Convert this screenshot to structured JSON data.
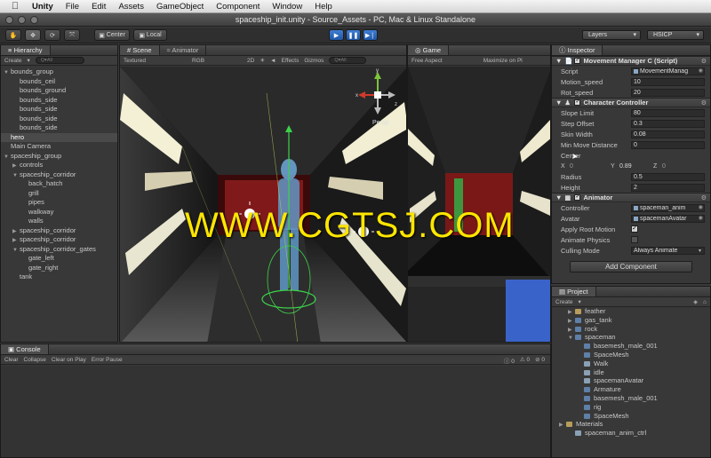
{
  "menubar": {
    "app": "Unity",
    "items": [
      "File",
      "Edit",
      "Assets",
      "GameObject",
      "Component",
      "Window",
      "Help"
    ]
  },
  "window": {
    "title": "spaceship_init.unity - Source_Assets - PC, Mac & Linux Standalone"
  },
  "toolbar": {
    "pivot_label": "Center",
    "space_label": "Local",
    "layers_label": "Layers",
    "layout_label": "HSICP"
  },
  "hierarchy": {
    "tab": "Hierarchy",
    "create_label": "Create",
    "search_placeholder": "Q▾All",
    "items": [
      {
        "label": "bounds_group",
        "depth": 0,
        "arrow": "▼"
      },
      {
        "label": "bounds_ceil",
        "depth": 1,
        "arrow": ""
      },
      {
        "label": "bounds_ground",
        "depth": 1,
        "arrow": ""
      },
      {
        "label": "bounds_side",
        "depth": 1,
        "arrow": ""
      },
      {
        "label": "bounds_side",
        "depth": 1,
        "arrow": ""
      },
      {
        "label": "bounds_side",
        "depth": 1,
        "arrow": ""
      },
      {
        "label": "bounds_side",
        "depth": 1,
        "arrow": ""
      },
      {
        "label": "hero",
        "depth": 0,
        "arrow": "",
        "selected": true
      },
      {
        "label": "Main Camera",
        "depth": 0,
        "arrow": ""
      },
      {
        "label": "spaceship_group",
        "depth": 0,
        "arrow": "▼"
      },
      {
        "label": "controls",
        "depth": 1,
        "arrow": "▶"
      },
      {
        "label": "spaceship_corridor",
        "depth": 1,
        "arrow": "▼"
      },
      {
        "label": "back_hatch",
        "depth": 2,
        "arrow": ""
      },
      {
        "label": "grill",
        "depth": 2,
        "arrow": ""
      },
      {
        "label": "pipes",
        "depth": 2,
        "arrow": ""
      },
      {
        "label": "walkway",
        "depth": 2,
        "arrow": ""
      },
      {
        "label": "walls",
        "depth": 2,
        "arrow": ""
      },
      {
        "label": "spaceship_corridor",
        "depth": 1,
        "arrow": "▶"
      },
      {
        "label": "spaceship_corridor",
        "depth": 1,
        "arrow": "▶"
      },
      {
        "label": "spaceship_corridor_gates",
        "depth": 1,
        "arrow": "▼"
      },
      {
        "label": "gate_left",
        "depth": 2,
        "arrow": ""
      },
      {
        "label": "gate_right",
        "depth": 2,
        "arrow": ""
      },
      {
        "label": "tank",
        "depth": 1,
        "arrow": ""
      }
    ]
  },
  "scene": {
    "tab": "Scene",
    "tab2": "Animator",
    "shading": "Textured",
    "render_mode": "RGB",
    "toggle_2d": "2D",
    "effects": "Effects",
    "gizmos": "Gizmos",
    "search_placeholder": "Q▾All",
    "persp_label": "Persp",
    "axis_y": "y",
    "axis_x": "x",
    "axis_z": "z"
  },
  "game": {
    "tab": "Game",
    "aspect": "Free Aspect",
    "maximize": "Maximize on Pl"
  },
  "inspector": {
    "tab": "Inspector",
    "movement": {
      "title": "Movement Manager C (Script)",
      "script_label": "Script",
      "script_value": "MovementManag",
      "motion_speed_label": "Motion_speed",
      "motion_speed_value": "10",
      "rot_speed_label": "Rot_speed",
      "rot_speed_value": "20"
    },
    "character": {
      "title": "Character Controller",
      "slope_label": "Slope Limit",
      "slope_value": "80",
      "step_label": "Step Offset",
      "step_value": "0.3",
      "skin_label": "Skin Width",
      "skin_value": "0.08",
      "minmove_label": "Min Move Distance",
      "minmove_value": "0",
      "center_label": "Center",
      "center_x_label": "X",
      "center_x": "0",
      "center_y_label": "Y",
      "center_y": "0.89",
      "center_z_label": "Z",
      "center_z": "0",
      "radius_label": "Radius",
      "radius_value": "0.5",
      "height_label": "Height",
      "height_value": "2"
    },
    "animator": {
      "title": "Animator",
      "controller_label": "Controller",
      "controller_value": "spaceman_anim",
      "avatar_label": "Avatar",
      "avatar_value": "spacemanAvatar",
      "root_label": "Apply Root Motion",
      "root_checked": "✓",
      "physics_label": "Animate Physics",
      "culling_label": "Culling Mode",
      "culling_value": "Always Animate"
    },
    "add_component": "Add Component"
  },
  "project": {
    "tab": "Project",
    "create_label": "Create",
    "items": [
      {
        "label": "feather",
        "depth": 1,
        "arrow": "▶",
        "kind": "folder"
      },
      {
        "label": "gas_tank",
        "depth": 1,
        "arrow": "▶",
        "kind": "mesh"
      },
      {
        "label": "rock",
        "depth": 1,
        "arrow": "▶",
        "kind": "mesh"
      },
      {
        "label": "spaceman",
        "depth": 1,
        "arrow": "▼",
        "kind": "mesh"
      },
      {
        "label": "basemesh_male_001",
        "depth": 2,
        "arrow": "",
        "kind": "mesh"
      },
      {
        "label": "SpaceMesh",
        "depth": 2,
        "arrow": "",
        "kind": "mesh"
      },
      {
        "label": "Walk",
        "depth": 2,
        "arrow": "",
        "kind": "anim"
      },
      {
        "label": "idle",
        "depth": 2,
        "arrow": "",
        "kind": "anim"
      },
      {
        "label": "spacemanAvatar",
        "depth": 2,
        "arrow": "",
        "kind": "anim"
      },
      {
        "label": "Armature",
        "depth": 2,
        "arrow": "",
        "kind": "mesh"
      },
      {
        "label": "basemesh_male_001",
        "depth": 2,
        "arrow": "",
        "kind": "mesh"
      },
      {
        "label": "rig",
        "depth": 2,
        "arrow": "",
        "kind": "mesh"
      },
      {
        "label": "SpaceMesh",
        "depth": 2,
        "arrow": "",
        "kind": "mesh"
      },
      {
        "label": "Materials",
        "depth": 0,
        "arrow": "▶",
        "kind": "folder"
      },
      {
        "label": "spaceman_anim_ctrl",
        "depth": 1,
        "arrow": "",
        "kind": "anim"
      }
    ]
  },
  "console": {
    "tab": "Console",
    "clear": "Clear",
    "collapse": "Collapse",
    "clear_on_play": "Clear on Play",
    "error_pause": "Error Pause",
    "count_info": "0",
    "count_warn": "0",
    "count_error": "0"
  },
  "watermark": "WWW.CGTSJ.COM"
}
